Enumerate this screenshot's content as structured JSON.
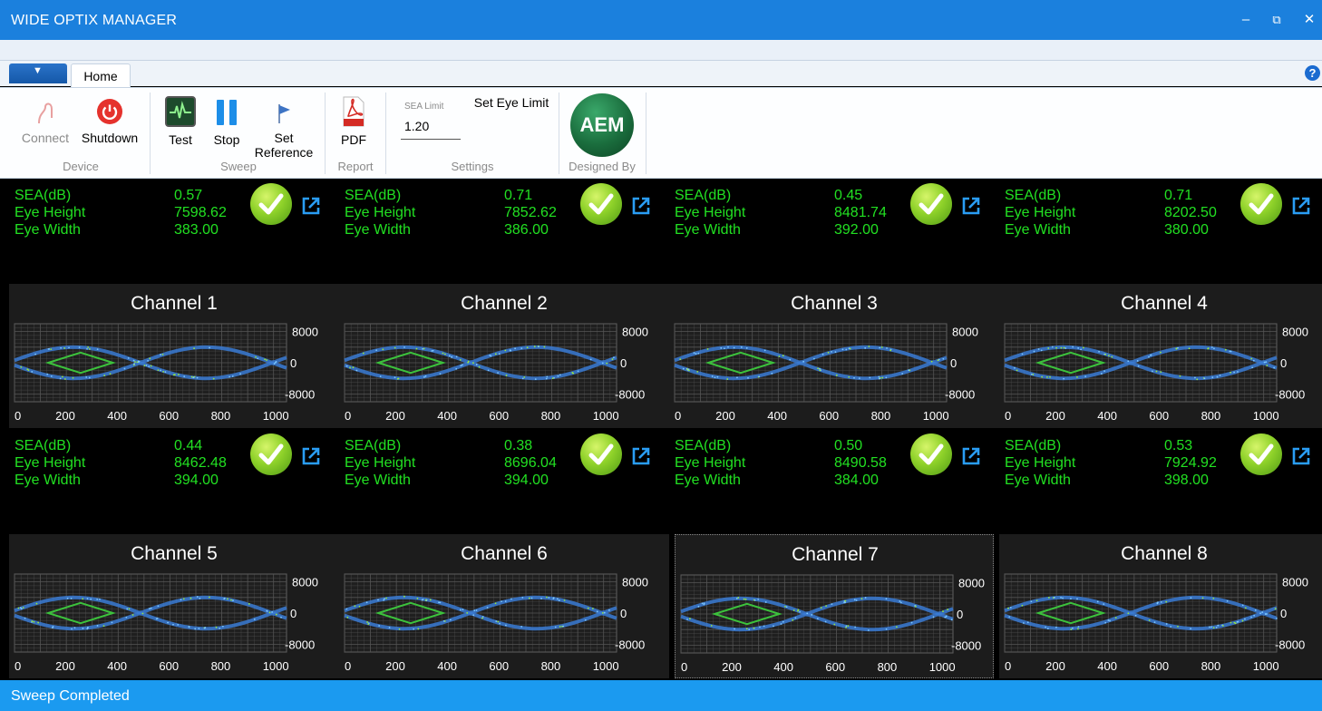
{
  "window": {
    "title": "WIDE OPTIX MANAGER",
    "minimize": "–",
    "restore": "⧉",
    "close": "✕"
  },
  "ribbon": {
    "tab": "Home",
    "help": "?",
    "buttons": {
      "connect": "Connect",
      "shutdown": "Shutdown",
      "test": "Test",
      "stop": "Stop",
      "set_reference_1": "Set",
      "set_reference_2": "Reference",
      "pdf": "PDF",
      "set_eye_limit": "Set Eye Limit",
      "aem": "AEM"
    },
    "sea_limit": {
      "label": "SEA Limit",
      "value": "1.20"
    },
    "groups": {
      "device": "Device",
      "sweep": "Sweep",
      "report": "Report",
      "settings": "Settings",
      "designed_by": "Designed By"
    }
  },
  "labels": {
    "sea": "SEA(dB)",
    "eye_height": "Eye Height",
    "eye_width": "Eye Width"
  },
  "channels": [
    {
      "name": "Channel 1",
      "sea": "0.57",
      "eye_height": "7598.62",
      "eye_width": "383.00"
    },
    {
      "name": "Channel 2",
      "sea": "0.71",
      "eye_height": "7852.62",
      "eye_width": "386.00"
    },
    {
      "name": "Channel 3",
      "sea": "0.45",
      "eye_height": "8481.74",
      "eye_width": "392.00"
    },
    {
      "name": "Channel 4",
      "sea": "0.71",
      "eye_height": "8202.50",
      "eye_width": "380.00"
    },
    {
      "name": "Channel 5",
      "sea": "0.44",
      "eye_height": "8462.48",
      "eye_width": "394.00"
    },
    {
      "name": "Channel 6",
      "sea": "0.38",
      "eye_height": "8696.04",
      "eye_width": "394.00"
    },
    {
      "name": "Channel 7",
      "sea": "0.50",
      "eye_height": "8490.58",
      "eye_width": "384.00"
    },
    {
      "name": "Channel 8",
      "sea": "0.53",
      "eye_height": "7924.92",
      "eye_width": "398.00"
    }
  ],
  "chart_data": {
    "type": "scatter",
    "xticks": [
      "0",
      "200",
      "400",
      "600",
      "800",
      "1000"
    ],
    "yticks": [
      "8000",
      "0",
      "-8000"
    ],
    "xlim": [
      0,
      1050
    ],
    "ylim": [
      -10000,
      10000
    ],
    "grid": true,
    "colors": {
      "eye": "#3a7bd5",
      "mask": "#3cc23c"
    }
  },
  "status": {
    "text": "Sweep Completed"
  }
}
